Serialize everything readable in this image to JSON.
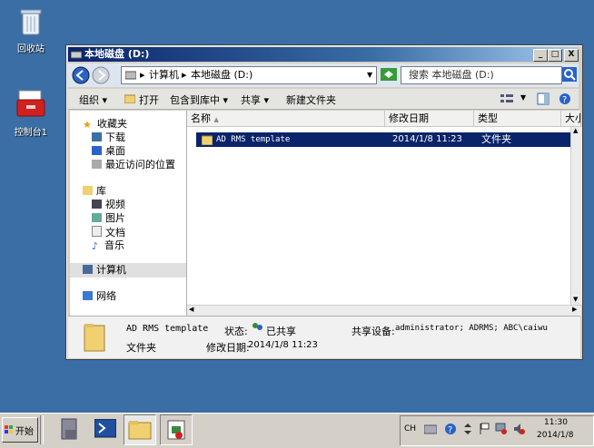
{
  "desktop": {
    "icons": [
      {
        "label": "回收站",
        "name": "recycle-bin"
      },
      {
        "label": "控制台1",
        "name": "console1"
      }
    ]
  },
  "window": {
    "title": "本地磁盘 (D:)",
    "title_buttons": {
      "minimize": "_",
      "maximize": "□",
      "close": "X"
    },
    "address": {
      "segments": [
        "计算机",
        "本地磁盘 (D:)"
      ],
      "sep": "▸"
    },
    "search_placeholder": "搜索 本地磁盘 (D:)",
    "toolbar": {
      "organize": "组织 ▾",
      "open": "打开",
      "include_library": "包含到库中 ▾",
      "share": "共享 ▾",
      "new_folder": "新建文件夹"
    },
    "nav": {
      "favorites": "收藏夹",
      "downloads": "下载",
      "desktop": "桌面",
      "recent": "最近访问的位置",
      "library": "库",
      "videos": "视频",
      "pictures": "图片",
      "documents": "文档",
      "music": "音乐",
      "computer": "计算机",
      "network": "网络"
    },
    "columns": {
      "name": "名称",
      "date": "修改日期",
      "type": "类型",
      "size": "大小"
    },
    "files": [
      {
        "name": "AD RMS template",
        "date": "2014/1/8 11:23",
        "type": "文件夹"
      }
    ],
    "details": {
      "name": "AD RMS template",
      "type": "文件夹",
      "status_label": "状态:",
      "status_value": "已共享",
      "modified_label": "修改日期:",
      "modified_value": "2014/1/8 11:23",
      "shared_label": "共享设备:",
      "shared_value": "administrator; ADRMS; ABC\\caiwu"
    }
  },
  "taskbar": {
    "start": "开始",
    "lang": "CH",
    "time": "11:30",
    "date": "2014/1/8"
  },
  "colors": {
    "desktop": "#3a6ea5",
    "title": "#0a246a",
    "selection": "#0a246a"
  }
}
